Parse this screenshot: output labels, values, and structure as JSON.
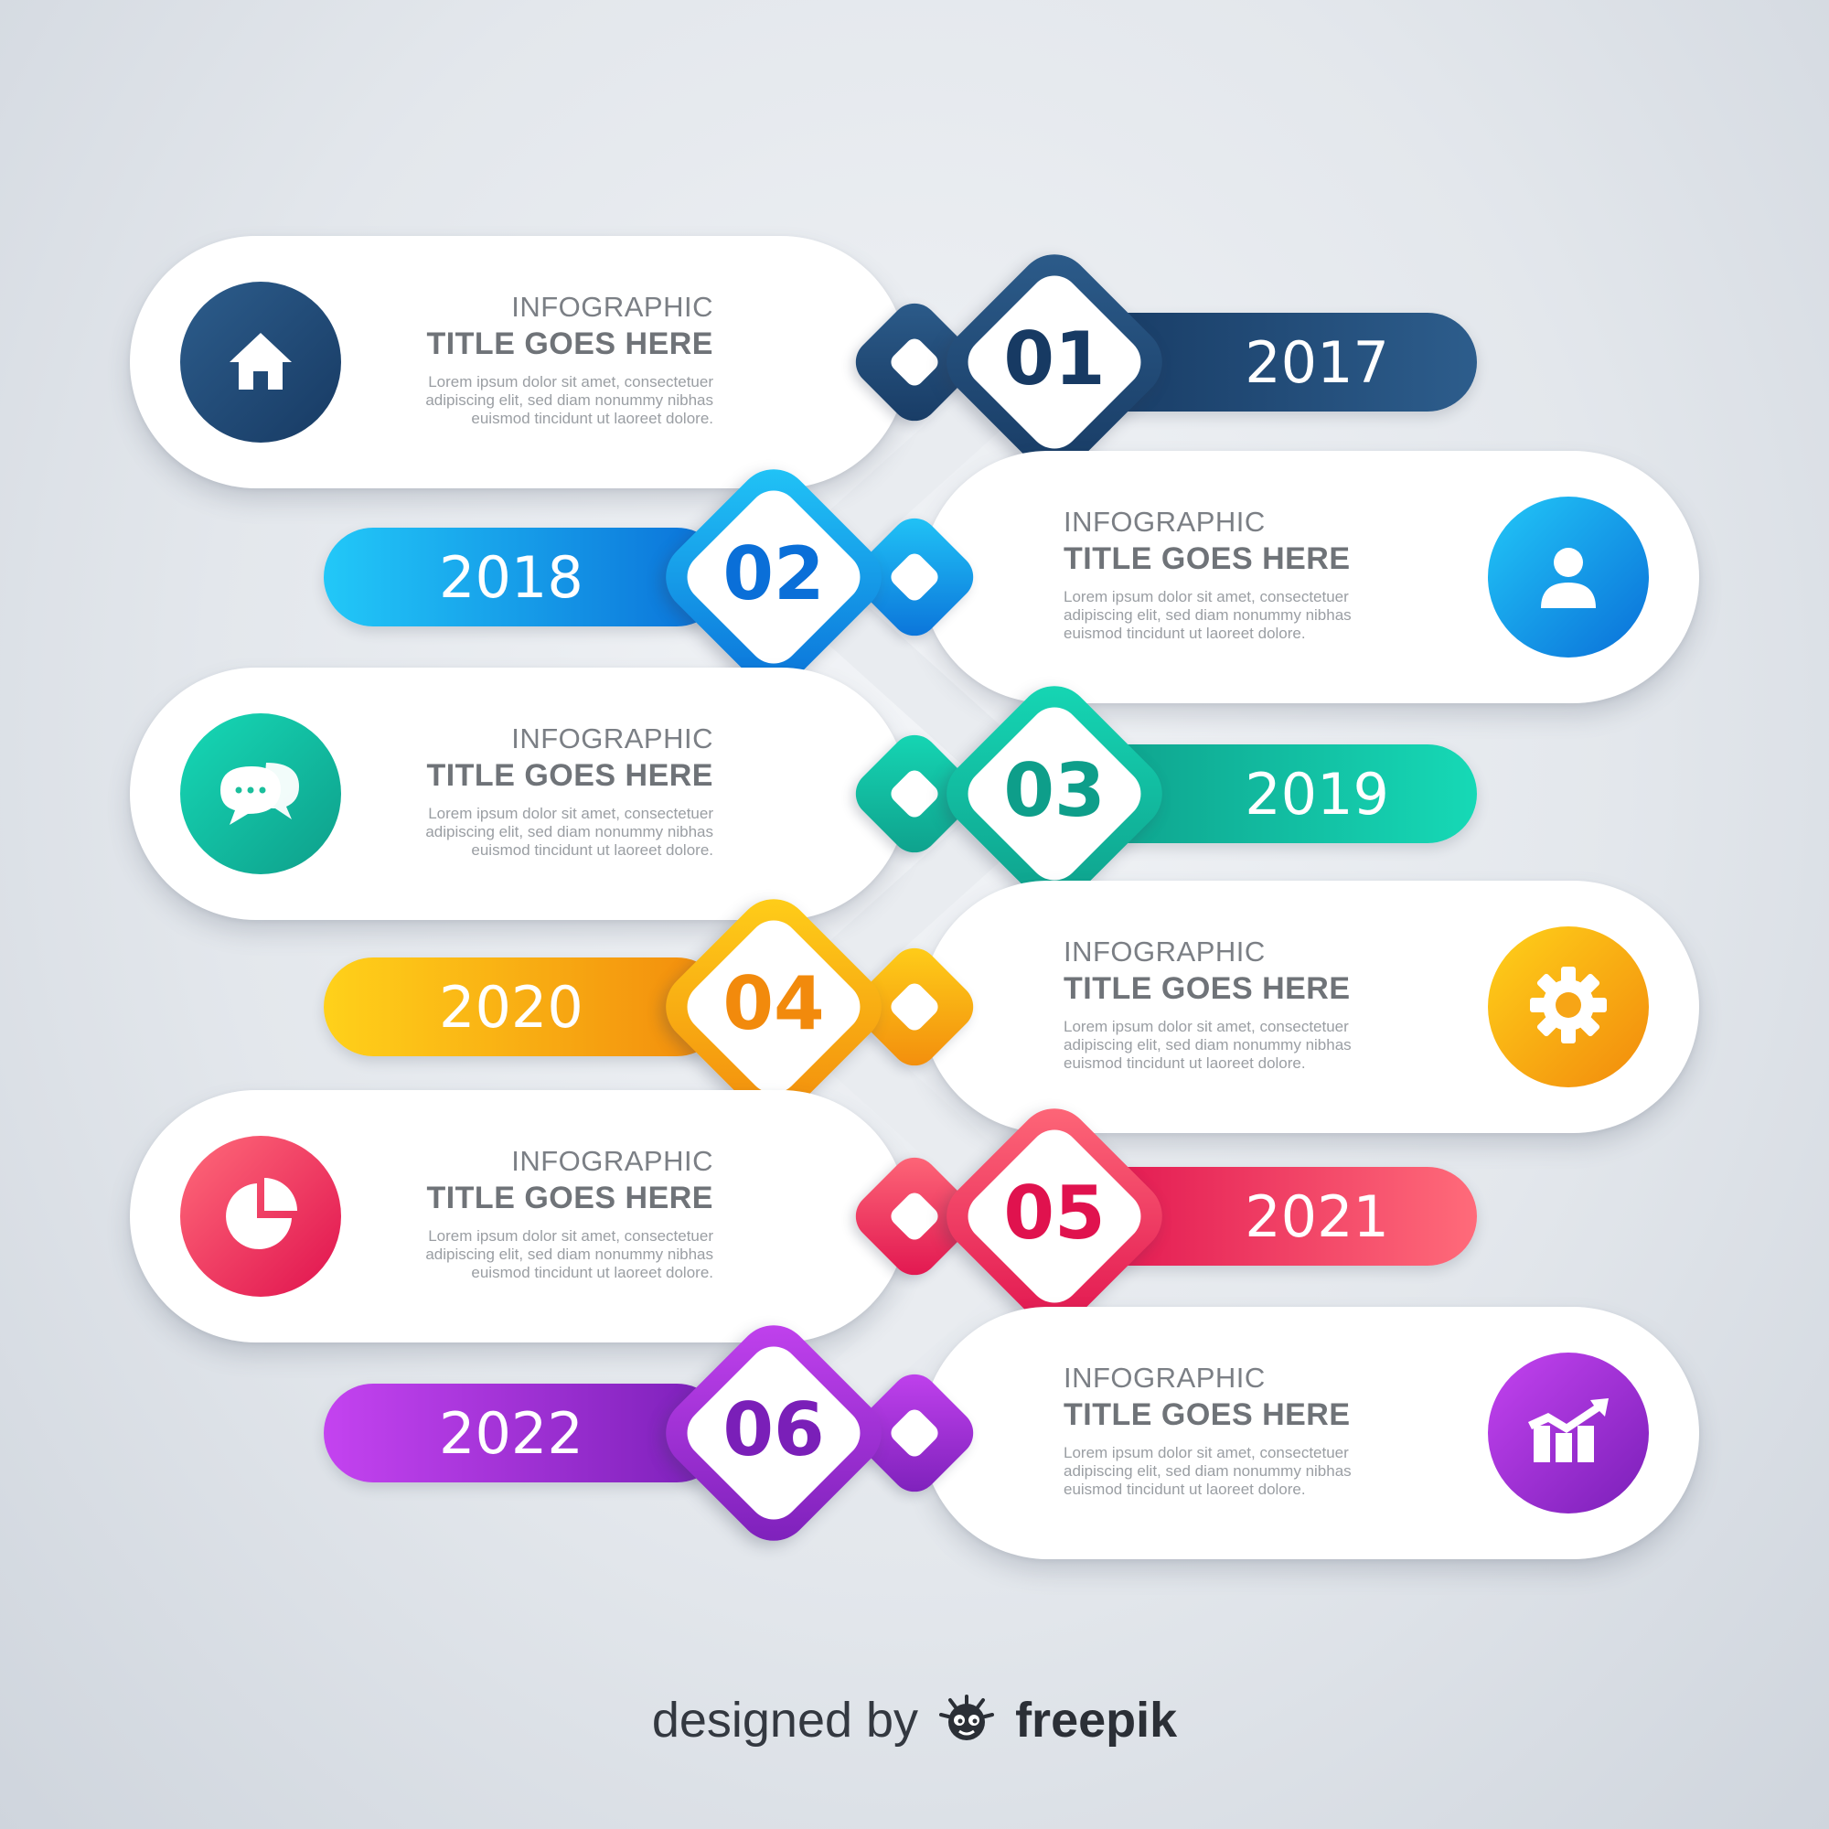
{
  "steps": [
    {
      "num": "01",
      "year": "2017",
      "side": "left",
      "icon": "home-icon",
      "title_small": "INFOGRAPHIC",
      "title_big": "TITLE GOES HERE",
      "body": [
        "Lorem ipsum dolor sit amet, consectetuer",
        "adipiscing elit, sed diam nonummy nibhas",
        "euismod tincidunt ut laoreet dolore."
      ],
      "color_a": "#2d5d8c",
      "color_b": "#173a63"
    },
    {
      "num": "02",
      "year": "2018",
      "side": "right",
      "icon": "user-icon",
      "title_small": "INFOGRAPHIC",
      "title_big": "TITLE GOES HERE",
      "body": [
        "Lorem ipsum dolor sit amet, consectetuer",
        "adipiscing elit, sed diam nonummy nibhas",
        "euismod tincidunt ut laoreet dolore."
      ],
      "color_a": "#22c8f8",
      "color_b": "#0a6fd8"
    },
    {
      "num": "03",
      "year": "2019",
      "side": "left",
      "icon": "chat-icon",
      "title_small": "INFOGRAPHIC",
      "title_big": "TITLE GOES HERE",
      "body": [
        "Lorem ipsum dolor sit amet, consectetuer",
        "adipiscing elit, sed diam nonummy nibhas",
        "euismod tincidunt ut laoreet dolore."
      ],
      "color_a": "#16d9b6",
      "color_b": "#0e9e8a"
    },
    {
      "num": "04",
      "year": "2020",
      "side": "right",
      "icon": "gear-icon",
      "title_small": "INFOGRAPHIC",
      "title_big": "TITLE GOES HERE",
      "body": [
        "Lorem ipsum dolor sit amet, consectetuer",
        "adipiscing elit, sed diam nonummy nibhas",
        "euismod tincidunt ut laoreet dolore."
      ],
      "color_a": "#ffd11a",
      "color_b": "#f28a0c"
    },
    {
      "num": "05",
      "year": "2021",
      "side": "left",
      "icon": "pie-chart-icon",
      "title_small": "INFOGRAPHIC",
      "title_big": "TITLE GOES HERE",
      "body": [
        "Lorem ipsum dolor sit amet, consectetuer",
        "adipiscing elit, sed diam nonummy nibhas",
        "euismod tincidunt ut laoreet dolore."
      ],
      "color_a": "#ff6b7a",
      "color_b": "#e0124e"
    },
    {
      "num": "06",
      "year": "2022",
      "side": "right",
      "icon": "bar-chart-icon",
      "title_small": "INFOGRAPHIC",
      "title_big": "TITLE GOES HERE",
      "body": [
        "Lorem ipsum dolor sit amet, consectetuer",
        "adipiscing elit, sed diam nonummy nibhas",
        "euismod tincidunt ut laoreet dolore."
      ],
      "color_a": "#c443f0",
      "color_b": "#7a1fb8"
    }
  ],
  "footer": {
    "prefix": "designed by",
    "brand": "freepik",
    "logo_icon": "freepik-logo-icon"
  }
}
